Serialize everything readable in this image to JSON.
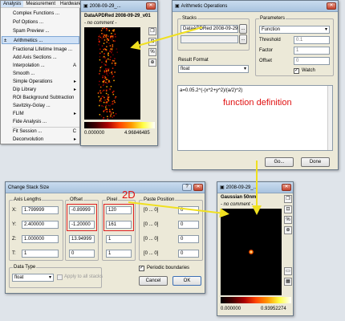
{
  "menu": {
    "bar": [
      "Analysis",
      "Measurement",
      "Hardware"
    ],
    "items": [
      {
        "label": "Complex Functions ...",
        "shortcut": ""
      },
      {
        "label": "Pof Options ...",
        "shortcut": ""
      },
      {
        "label": "Spam Preview ...",
        "shortcut": ""
      },
      {
        "label": "Arithmetics ...",
        "shortcut": ""
      },
      {
        "label": "Fractional Lifetime Image ...",
        "shortcut": ""
      },
      {
        "label": "Add Axis Sections ...",
        "shortcut": ""
      },
      {
        "label": "Interpolation ...",
        "shortcut": "A"
      },
      {
        "label": "Smooth ...",
        "shortcut": ""
      },
      {
        "label": "Simple Operations",
        "shortcut": "▸"
      },
      {
        "label": "Dip Library",
        "shortcut": "▸"
      },
      {
        "label": "ROI Background Subtraction",
        "shortcut": ""
      },
      {
        "label": "Savitzky-Golay ...",
        "shortcut": ""
      },
      {
        "label": "FLIM",
        "shortcut": "▸"
      },
      {
        "label": "Fide Analysis ...",
        "shortcut": ""
      },
      {
        "label": "Fit Session ...",
        "shortcut": "C"
      },
      {
        "label": "Deconvolution",
        "shortcut": "▸"
      }
    ]
  },
  "image1": {
    "title": "2008-09-29_...",
    "name": "DataAPDRed 2008-09-29_v01",
    "comment": "- no comment -",
    "min": "0.000000",
    "max": "4.96846485"
  },
  "arith": {
    "title": "Arithmetic Operations",
    "stacks_label": "Stacks",
    "stack1": "DataAPDRed 2008-09-29_...",
    "params_label": "Parameters",
    "function": "Function",
    "threshold_label": "Threshold",
    "threshold": "0.1",
    "factor_label": "Factor",
    "factor": "1",
    "offset_label": "Offset",
    "offset": "0",
    "watch_label": "Watch",
    "result_label": "Result Format",
    "result_format": "float",
    "formula": "a=0.05.2^(-(x^2+y^2)/(a/2)^2)",
    "go": "Go...",
    "done": "Done"
  },
  "annot": {
    "function_def": "function definition",
    "twoD": "2D"
  },
  "stack": {
    "title": "Change Stack Size",
    "axis_label": "Axis Lengths",
    "offset_label": "Offset",
    "pixel_label": "Pixel",
    "paste_label": "Paste Position",
    "rows": [
      {
        "axis": "X:",
        "length": "1.799999",
        "offset": "-0.89999",
        "pixel": "120",
        "paste": "[0 ... 0]",
        "pos": "0"
      },
      {
        "axis": "Y:",
        "length": "2.400000",
        "offset": "-1.20000",
        "pixel": "161",
        "paste": "[0 ... 0]",
        "pos": "0"
      },
      {
        "axis": "Z:",
        "length": "1.000000",
        "offset": "13.94999",
        "pixel": "1",
        "paste": "[0 ... 0]",
        "pos": "0"
      },
      {
        "axis": "T:",
        "length": "1",
        "offset": "0",
        "pixel": "1",
        "paste": "[0 ... 0]",
        "pos": "0"
      }
    ],
    "dtype_label": "Data Type",
    "dtype": "float",
    "apply_all": "Apply to all stacks",
    "periodic": "Periodic boundaries",
    "cancel": "Cancel",
    "ok": "OK"
  },
  "image2": {
    "title": "2008-09-29_...",
    "name": "Gaussian 50nm",
    "comment": "- no comment -",
    "min": "0.000000",
    "max": "0.93952274"
  },
  "colors": {
    "annotation": "#e01010",
    "arrow": "#f0e020"
  }
}
